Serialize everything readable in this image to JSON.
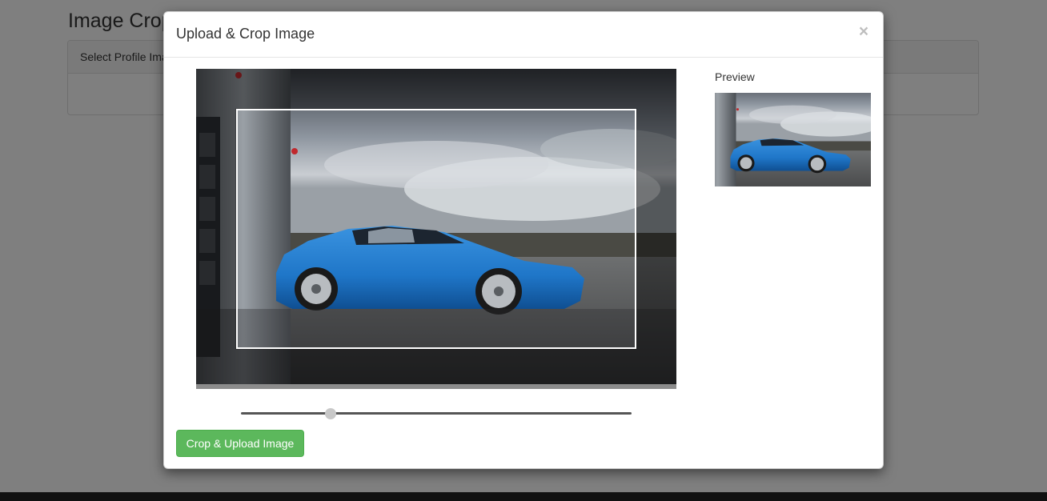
{
  "page": {
    "title": "Image Crop",
    "panel_heading": "Select Profile Image"
  },
  "modal": {
    "title": "Upload & Crop Image",
    "close_label": "×",
    "preview_label": "Preview",
    "submit_label": "Crop & Upload Image"
  },
  "zoom": {
    "value": 0.23
  },
  "colors": {
    "button_success": "#5cb85c",
    "car_blue": "#1f76c8"
  },
  "icons": {
    "close": "close-icon"
  }
}
